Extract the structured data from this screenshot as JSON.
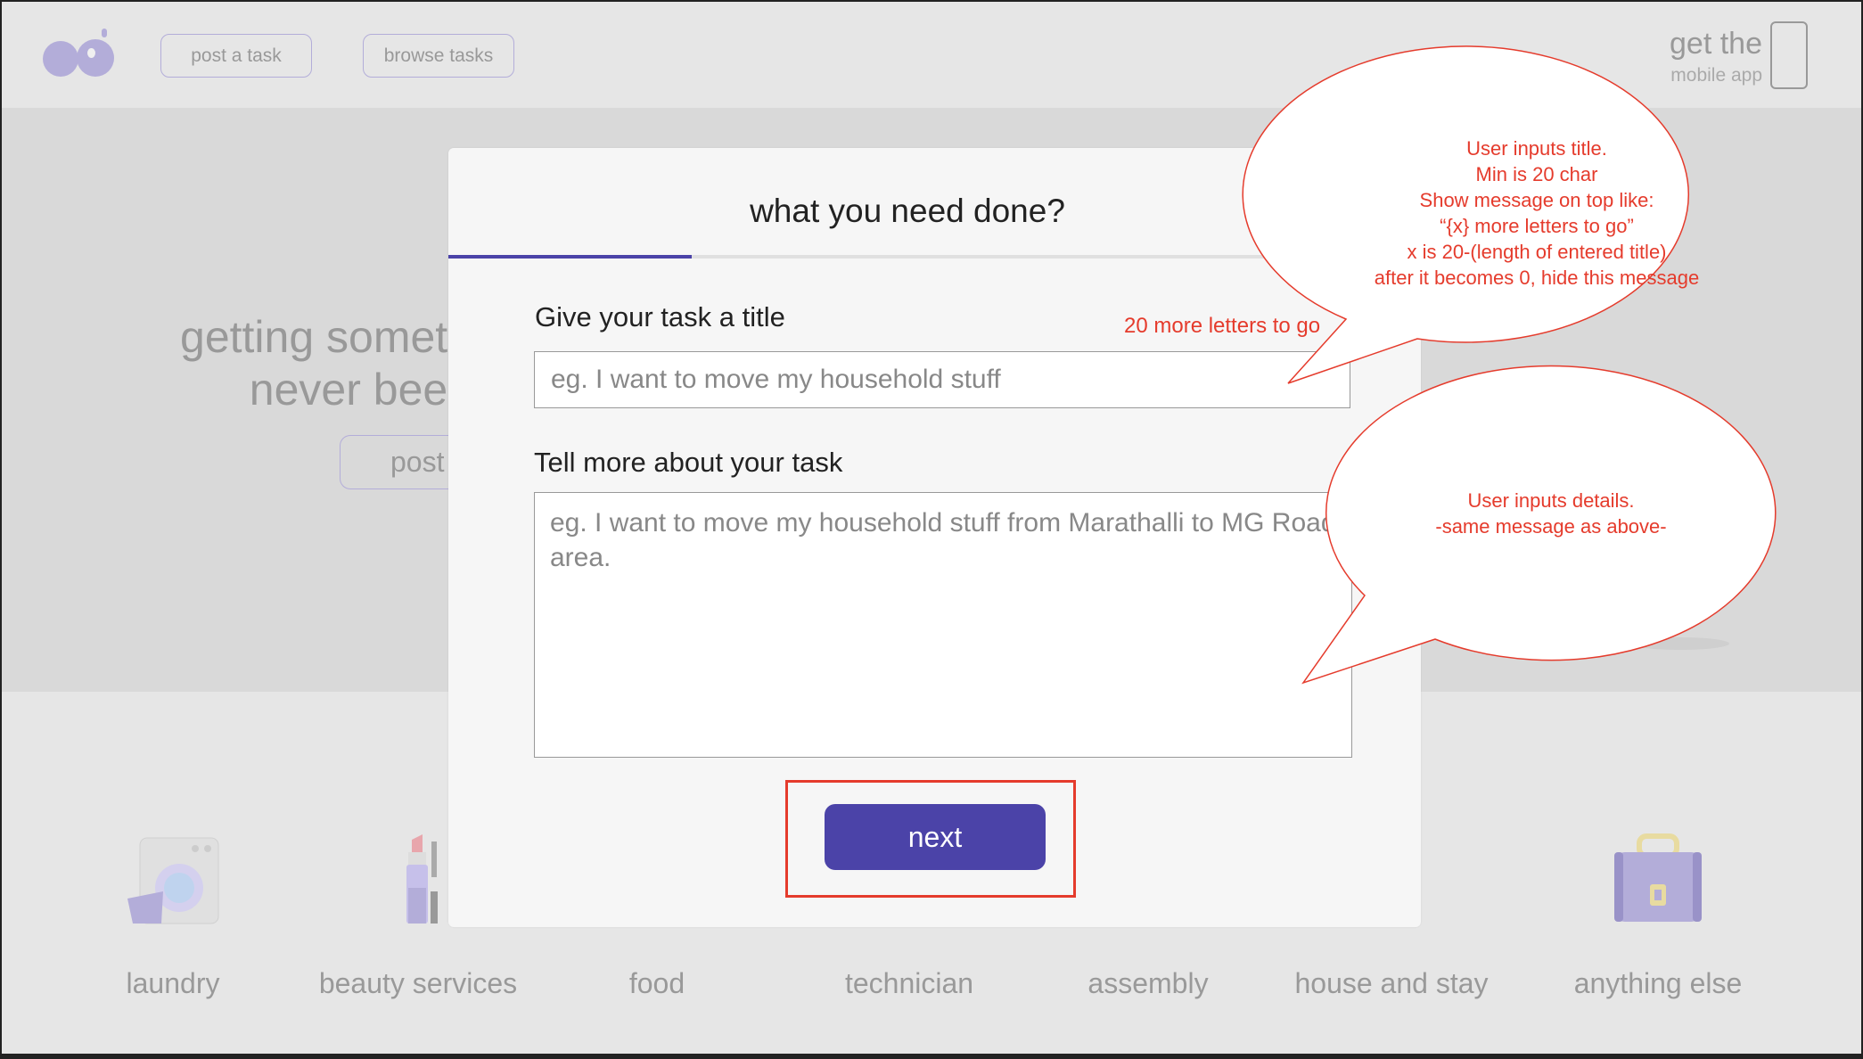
{
  "header": {
    "post_task": "post a task",
    "browse_tasks": "browse tasks",
    "app_big": "get the",
    "app_small": "mobile app"
  },
  "hero": {
    "line1": "getting someth",
    "line2": "never been",
    "button_partial": "post"
  },
  "categories": [
    {
      "label": "laundry",
      "icon": "washing-machine-icon"
    },
    {
      "label": "beauty services",
      "icon": "lipstick-icon"
    },
    {
      "label": "food",
      "icon": "food-icon"
    },
    {
      "label": "technician",
      "icon": "technician-icon"
    },
    {
      "label": "assembly",
      "icon": "assembly-icon"
    },
    {
      "label": "house and stay",
      "icon": "house-icon"
    },
    {
      "label": "anything else",
      "icon": "briefcase-icon"
    }
  ],
  "modal": {
    "title": "what you need done?",
    "progress_fraction": 0.25,
    "title_label": "Give your task a title",
    "title_counter": "20 more letters to go",
    "title_placeholder": "eg. I want to move my household stuff",
    "title_value": "",
    "details_label": "Tell more about your task",
    "details_placeholder": "eg. I want to move my household stuff from Marathalli to MG Road area.",
    "details_value": "",
    "next_label": "next"
  },
  "annotations": {
    "title_note": [
      "User inputs title.",
      "Min is 20 char",
      "Show message on top like:",
      "“{x} more letters to go”",
      "x is 20-(length of entered title)",
      "after it becomes 0, hide this message"
    ],
    "details_note": [
      "User inputs details.",
      "-same message as above-"
    ]
  },
  "colors": {
    "accent": "#4b43a8",
    "annotation": "#e53b2c",
    "muted_accent": "#b3add9"
  }
}
